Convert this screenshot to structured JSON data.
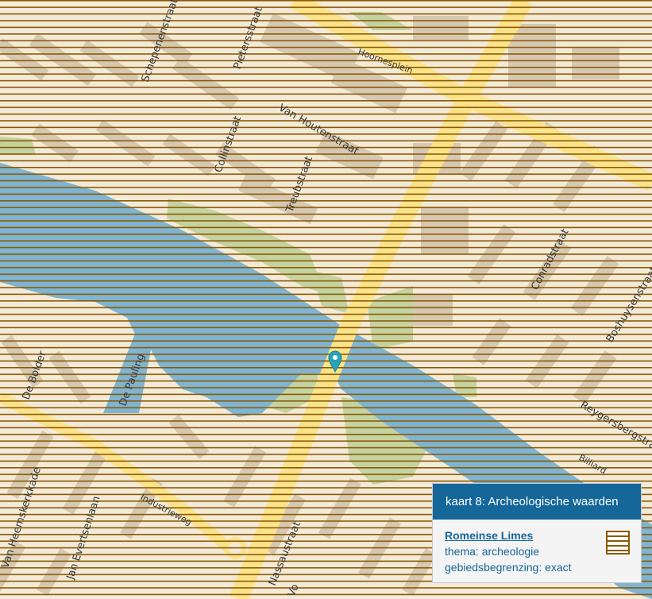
{
  "map": {
    "streets": {
      "schepenenstraat": "Schepenenstraat",
      "pieterstraat": "Pietersstraat",
      "hoornesplein": "Hoornesplein",
      "van_houtenstraat": "Van Houtenstraat",
      "collinstraat": "Collinstraat",
      "treubstraat": "Treubstraat",
      "conradstraat": "Conradstraat",
      "boshuysenstraat": "Boshuysenstraat",
      "de_bolder": "De Bolder",
      "de_pauling": "De Pauling",
      "reygersbergstraat": "Reygersbergstraat",
      "billiard": "Billiard",
      "van_heemskerkkade": "Van Heemskerkkade",
      "jan_evertsenlaan": "Jan Evertsenlaan",
      "industrieweg": "Industrieweg",
      "nassaustraat": "Nassaustraat",
      "vo": "Vo"
    },
    "marker_icon": "map-pin-icon",
    "colors": {
      "background": "#f3ead9",
      "water": "#7fb4d3",
      "green": "#c4d3a1",
      "building": "#d6c8b3",
      "main_road": "#fbe38c",
      "hatch": "#8a5a00",
      "marker": "#29a3b8"
    }
  },
  "info_card": {
    "header": "kaart 8: Archeologische waarden",
    "title": "Romeinse Limes",
    "thema": "thema: archeologie",
    "gebied": "gebiedsbegrenzing: exact",
    "legend_icon": "hatched-legend-icon"
  }
}
